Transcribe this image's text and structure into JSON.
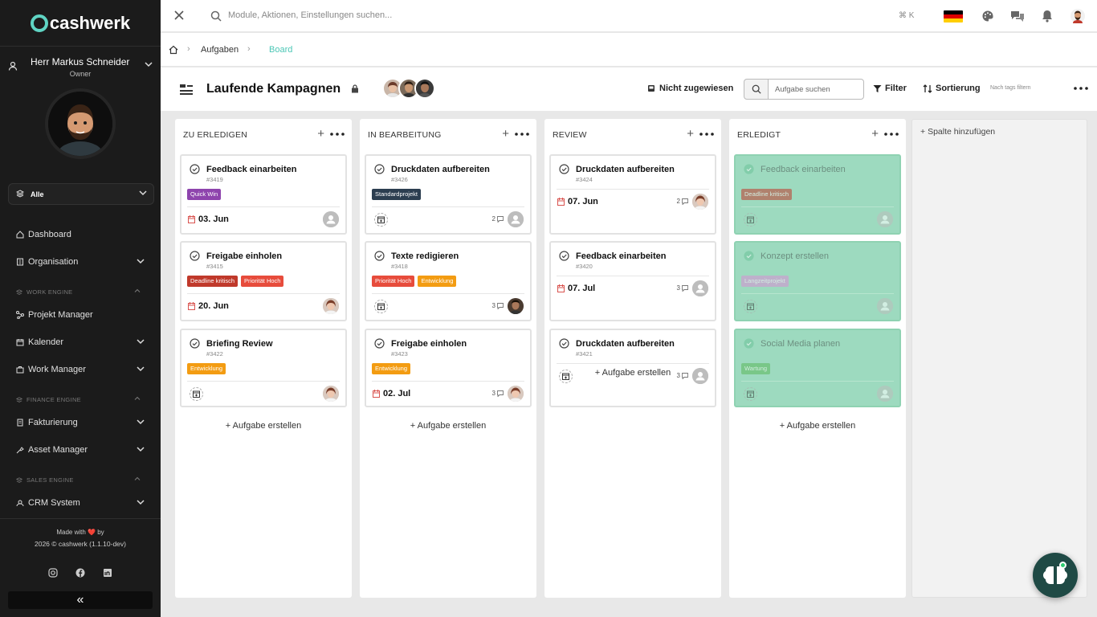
{
  "sidebar": {
    "brand": "cashwerk",
    "user": {
      "name": "Herr Markus Schneider",
      "role": "Owner"
    },
    "scope": "Alle",
    "nav": {
      "dashboard": "Dashboard",
      "organisation": "Organisation",
      "work_engine": "WORK ENGINE",
      "projekt_manager": "Projekt Manager",
      "kalender": "Kalender",
      "work_manager": "Work Manager",
      "finance_engine": "FINANCE ENGINE",
      "fakturierung": "Fakturierung",
      "asset_manager": "Asset Manager",
      "sales_engine": "SALES ENGINE",
      "crm_system": "CRM System"
    },
    "footer": {
      "made_with": "Made with ❤️ by",
      "copyright": "2026 © cashwerk (1.1.10-dev)"
    },
    "collapse_label": "«"
  },
  "topbar": {
    "search_placeholder": "Module, Aktionen, Einstellungen suchen...",
    "shortcut": "⌘ K"
  },
  "breadcrumb": {
    "items": [
      "Aufgaben",
      "Board"
    ],
    "separator": "›"
  },
  "header": {
    "title": "Laufende Kampagnen",
    "unassigned": "Nicht zugewiesen",
    "search_placeholder": "Aufgabe suchen",
    "filter": "Filter",
    "sort": "Sortierung",
    "tag_filter": "Nach tags filtern"
  },
  "colors": {
    "accent": "#4cc7b6",
    "tag_purple": "#8e44ad",
    "tag_red": "#c0392b",
    "tag_coral": "#e74c3c",
    "tag_orange": "#f39c12",
    "tag_dark": "#2c3e50",
    "tag_pink": "#d98fd6",
    "tag_green": "#5cb85c",
    "date_red": "#d9534f",
    "done_green": "#9ddabf"
  },
  "board": {
    "add_task_label": "Aufgabe erstellen",
    "add_column_label": "Spalte hinzufügen",
    "columns": [
      {
        "title": "ZU ERLEDIGEN",
        "cards": [
          {
            "title": "Feedback einarbeiten",
            "id": "#3419",
            "tags": [
              {
                "label": "Quick Win",
                "color": "#8e44ad"
              }
            ],
            "date": "03. Jun",
            "comments": "",
            "assignee": "placeholder"
          },
          {
            "title": "Freigabe einholen",
            "id": "#3415",
            "tags": [
              {
                "label": "Deadline kritisch",
                "color": "#c0392b"
              },
              {
                "label": "Priorität Hoch",
                "color": "#e74c3c"
              }
            ],
            "date": "20. Jun",
            "comments": "",
            "assignee": "woman"
          },
          {
            "title": "Briefing Review",
            "id": "#3422",
            "tags": [
              {
                "label": "Entwicklung",
                "color": "#f39c12"
              }
            ],
            "date": "",
            "comments": "",
            "assignee": "woman"
          }
        ]
      },
      {
        "title": "IN BEARBEITUNG",
        "cards": [
          {
            "title": "Druckdaten aufbereiten",
            "id": "#3426",
            "tags": [
              {
                "label": "Standardprojekt",
                "color": "#2c3e50"
              }
            ],
            "date": "",
            "comments": "2",
            "assignee": "placeholder"
          },
          {
            "title": "Texte redigieren",
            "id": "#3418",
            "tags": [
              {
                "label": "Priorität Hoch",
                "color": "#e74c3c"
              },
              {
                "label": "Entwicklung",
                "color": "#f39c12"
              }
            ],
            "date": "",
            "comments": "3",
            "assignee": "man"
          },
          {
            "title": "Freigabe einholen",
            "id": "#3423",
            "tags": [
              {
                "label": "Entwicklung",
                "color": "#f39c12"
              }
            ],
            "date": "02. Jul",
            "comments": "3",
            "assignee": "woman"
          }
        ]
      },
      {
        "title": "REVIEW",
        "cards": [
          {
            "title": "Druckdaten aufbereiten",
            "id": "#3424",
            "tags": [],
            "date": "07. Jun",
            "comments": "2",
            "assignee": "woman"
          },
          {
            "title": "Feedback einarbeiten",
            "id": "#3420",
            "tags": [],
            "date": "07. Jul",
            "comments": "3",
            "assignee": "placeholder"
          },
          {
            "title": "Druckdaten aufbereiten",
            "id": "#3421",
            "tags": [],
            "date": "",
            "comments": "3",
            "assignee": "placeholder"
          }
        ]
      },
      {
        "title": "ERLEDIGT",
        "cards": [
          {
            "title": "Feedback einarbeiten",
            "id": "",
            "tags": [
              {
                "label": "Deadline kritisch",
                "color": "#c0392b"
              }
            ],
            "date": "",
            "comments": "",
            "assignee": "placeholder"
          },
          {
            "title": "Konzept erstellen",
            "id": "",
            "tags": [
              {
                "label": "Langzeitprojekt",
                "color": "#d98fd6"
              }
            ],
            "date": "",
            "comments": "",
            "assignee": "placeholder"
          },
          {
            "title": "Social Media planen",
            "id": "",
            "tags": [
              {
                "label": "Wartung",
                "color": "#5cb85c"
              }
            ],
            "date": "",
            "comments": "",
            "assignee": "placeholder"
          }
        ]
      }
    ]
  }
}
